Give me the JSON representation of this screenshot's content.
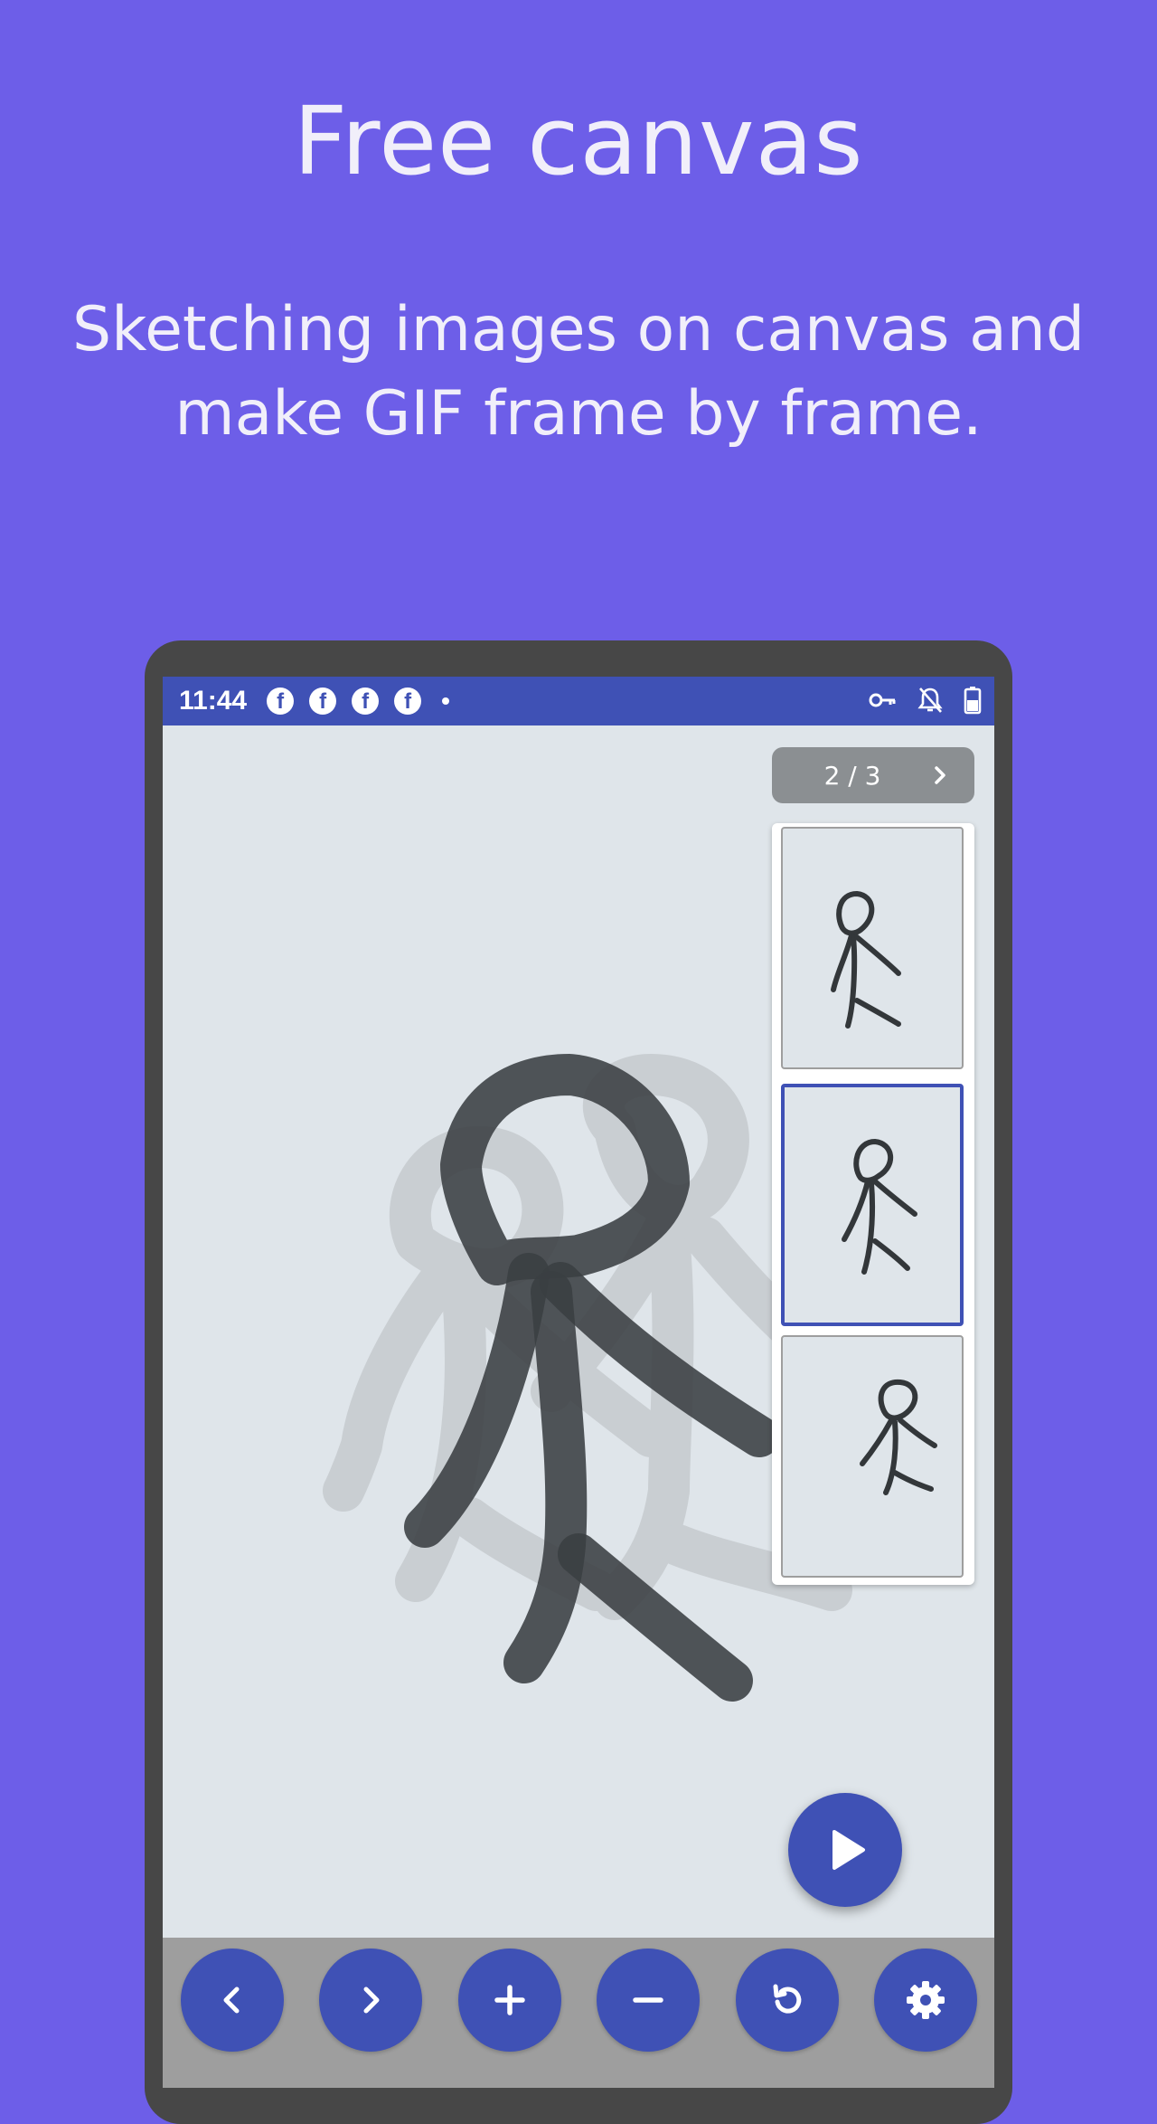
{
  "promo": {
    "title": "Free canvas",
    "subtitle_line1": "Sketching images on canvas and",
    "subtitle_line2": "make GIF frame by frame."
  },
  "statusbar": {
    "time": "11:44",
    "notification_icons": [
      "facebook-icon",
      "facebook-icon",
      "facebook-icon",
      "facebook-icon"
    ],
    "right_icons": [
      "vpn-key-icon",
      "notifications-off-icon",
      "battery-icon"
    ]
  },
  "pager": {
    "label": "2 / 3",
    "current": 2,
    "total": 3
  },
  "frames": [
    {
      "index": 1,
      "selected": false
    },
    {
      "index": 2,
      "selected": true
    },
    {
      "index": 3,
      "selected": false
    }
  ],
  "fab": {
    "icon": "play-icon"
  },
  "toolbar": {
    "buttons": [
      "chevron-left-icon",
      "chevron-right-icon",
      "plus-icon",
      "minus-icon",
      "undo-icon",
      "settings-icon"
    ]
  },
  "colors": {
    "background": "#6d5ee8",
    "accent": "#3f51b5",
    "canvas": "#dfe5ea",
    "ink": "#3a3f42",
    "toolbar": "#9e9e9e"
  }
}
